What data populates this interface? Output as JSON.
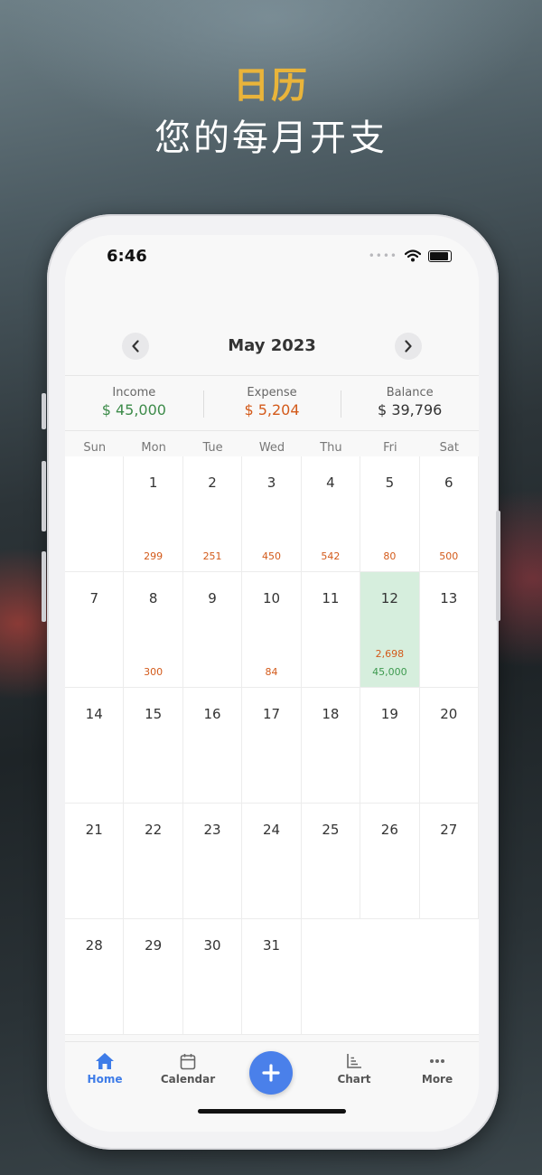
{
  "promo": {
    "title": "日历",
    "subtitle": "您的每月开支"
  },
  "status_bar": {
    "time": "6:46",
    "signal_dots": "••••"
  },
  "header": {
    "month": "May 2023",
    "prev_icon": "chevron-left-icon",
    "next_icon": "chevron-right-icon"
  },
  "summary": {
    "income_label": "Income",
    "income_value": "$ 45,000",
    "expense_label": "Expense",
    "expense_value": "$ 5,204",
    "balance_label": "Balance",
    "balance_value": "$ 39,796"
  },
  "weekdays": [
    "Sun",
    "Mon",
    "Tue",
    "Wed",
    "Thu",
    "Fri",
    "Sat"
  ],
  "calendar": {
    "cells": [
      {
        "day": "",
        "expense": "",
        "income": ""
      },
      {
        "day": "1",
        "expense": "299",
        "income": ""
      },
      {
        "day": "2",
        "expense": "251",
        "income": ""
      },
      {
        "day": "3",
        "expense": "450",
        "income": ""
      },
      {
        "day": "4",
        "expense": "542",
        "income": ""
      },
      {
        "day": "5",
        "expense": "80",
        "income": ""
      },
      {
        "day": "6",
        "expense": "500",
        "income": ""
      },
      {
        "day": "7",
        "expense": "",
        "income": ""
      },
      {
        "day": "8",
        "expense": "300",
        "income": ""
      },
      {
        "day": "9",
        "expense": "",
        "income": ""
      },
      {
        "day": "10",
        "expense": "84",
        "income": ""
      },
      {
        "day": "11",
        "expense": "",
        "income": ""
      },
      {
        "day": "12",
        "expense": "2,698",
        "income": "45,000",
        "selected": true
      },
      {
        "day": "13",
        "expense": "",
        "income": ""
      },
      {
        "day": "14",
        "expense": "",
        "income": ""
      },
      {
        "day": "15",
        "expense": "",
        "income": ""
      },
      {
        "day": "16",
        "expense": "",
        "income": ""
      },
      {
        "day": "17",
        "expense": "",
        "income": ""
      },
      {
        "day": "18",
        "expense": "",
        "income": ""
      },
      {
        "day": "19",
        "expense": "",
        "income": ""
      },
      {
        "day": "20",
        "expense": "",
        "income": ""
      },
      {
        "day": "21",
        "expense": "",
        "income": ""
      },
      {
        "day": "22",
        "expense": "",
        "income": ""
      },
      {
        "day": "23",
        "expense": "",
        "income": ""
      },
      {
        "day": "24",
        "expense": "",
        "income": ""
      },
      {
        "day": "25",
        "expense": "",
        "income": ""
      },
      {
        "day": "26",
        "expense": "",
        "income": ""
      },
      {
        "day": "27",
        "expense": "",
        "income": ""
      },
      {
        "day": "28",
        "expense": "",
        "income": ""
      },
      {
        "day": "29",
        "expense": "",
        "income": ""
      },
      {
        "day": "30",
        "expense": "",
        "income": ""
      },
      {
        "day": "31",
        "expense": "",
        "income": ""
      }
    ]
  },
  "tabbar": {
    "home": "Home",
    "calendar": "Calendar",
    "chart": "Chart",
    "more": "More",
    "add_icon": "plus-icon",
    "active_tab": "Home"
  },
  "colors": {
    "accent": "#4a80ea",
    "income": "#3d8b4a",
    "expense": "#d35a1a",
    "selected_day": "#d6eedd",
    "promo_title": "#e9b43a"
  }
}
